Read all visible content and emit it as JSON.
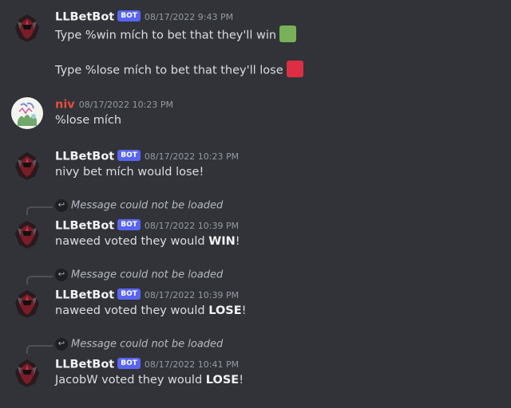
{
  "messages": [
    {
      "username": "LLBetBot",
      "bot_tag": "BOT",
      "timestamp": "08/17/2022 9:43 PM",
      "line1": "Type %win mích to bet that they'll win",
      "line2": "Type %lose mích to bet that they'll lose",
      "emoji_win_color": "#78b159",
      "emoji_lose_color": "#dd2e44"
    },
    {
      "username": "niv",
      "timestamp": "08/17/2022 10:23 PM",
      "content": "%lose mích",
      "username_color": "#e74c3c"
    },
    {
      "username": "LLBetBot",
      "bot_tag": "BOT",
      "timestamp": "08/17/2022 10:23 PM",
      "content": "nivy bet mích would lose!"
    },
    {
      "reply": "Message could not be loaded",
      "username": "LLBetBot",
      "bot_tag": "BOT",
      "timestamp": "08/17/2022 10:39 PM",
      "content_pre": "naweed voted they would ",
      "content_bold": "WIN",
      "content_post": "!"
    },
    {
      "reply": "Message could not be loaded",
      "username": "LLBetBot",
      "bot_tag": "BOT",
      "timestamp": "08/17/2022 10:39 PM",
      "content_pre": "naweed voted they would ",
      "content_bold": "LOSE",
      "content_post": "!"
    },
    {
      "reply": "Message could not be loaded",
      "username": "LLBetBot",
      "bot_tag": "BOT",
      "timestamp": "08/17/2022 10:41 PM",
      "content_pre": "JacobW voted they would ",
      "content_bold": "LOSE",
      "content_post": "!"
    }
  ]
}
